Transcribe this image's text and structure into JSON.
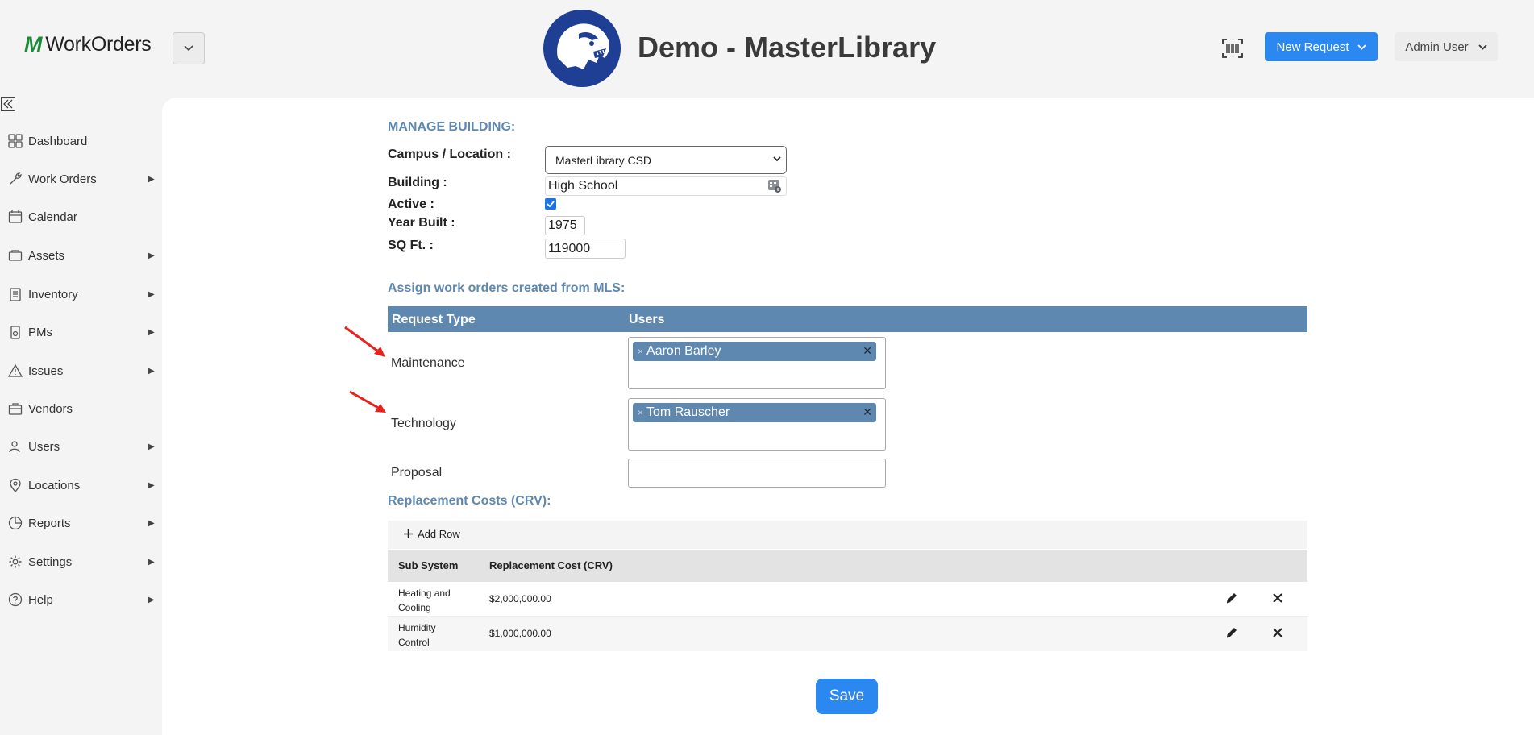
{
  "header": {
    "logo_mark": "M",
    "logo_text": "WorkOrders",
    "title": "Demo - MasterLibrary",
    "new_request_label": "New Request",
    "admin_user_label": "Admin User"
  },
  "sidebar": {
    "items": [
      {
        "label": "Dashboard",
        "icon": "dashboard-icon",
        "has_submenu": false
      },
      {
        "label": "Work Orders",
        "icon": "work-orders-icon",
        "has_submenu": true
      },
      {
        "label": "Calendar",
        "icon": "calendar-icon",
        "has_submenu": false
      },
      {
        "label": "Assets",
        "icon": "assets-icon",
        "has_submenu": true
      },
      {
        "label": "Inventory",
        "icon": "inventory-icon",
        "has_submenu": true
      },
      {
        "label": "PMs",
        "icon": "pms-icon",
        "has_submenu": true
      },
      {
        "label": "Issues",
        "icon": "warning-icon",
        "has_submenu": true
      },
      {
        "label": "Vendors",
        "icon": "briefcase-icon",
        "has_submenu": false
      },
      {
        "label": "Users",
        "icon": "users-icon",
        "has_submenu": true
      },
      {
        "label": "Locations",
        "icon": "location-pin-icon",
        "has_submenu": true
      },
      {
        "label": "Reports",
        "icon": "reports-icon",
        "has_submenu": true
      },
      {
        "label": "Settings",
        "icon": "gear-icon",
        "has_submenu": true
      },
      {
        "label": "Help",
        "icon": "help-icon",
        "has_submenu": true
      }
    ]
  },
  "manage_building": {
    "title": "MANAGE BUILDING:",
    "campus_label": "Campus / Location :",
    "campus_value": "MasterLibrary CSD",
    "building_label": "Building :",
    "building_value": "High School",
    "active_label": "Active :",
    "active_checked": true,
    "year_built_label": "Year Built :",
    "year_built_value": "1975",
    "sqft_label": "SQ Ft. :",
    "sqft_value": "119000"
  },
  "assign": {
    "title": "Assign work orders created from MLS:",
    "col_request_type": "Request Type",
    "col_users": "Users",
    "rows": [
      {
        "request_type": "Maintenance",
        "user": "Aaron Barley"
      },
      {
        "request_type": "Technology",
        "user": "Tom Rauscher"
      },
      {
        "request_type": "Proposal",
        "user": ""
      }
    ]
  },
  "crv": {
    "title": "Replacement Costs (CRV):",
    "add_row_label": "Add Row",
    "col_sub_system": "Sub System",
    "col_cost": "Replacement Cost (CRV)",
    "rows": [
      {
        "sub_system": "Heating and Cooling",
        "cost": "$2,000,000.00"
      },
      {
        "sub_system": "Humidity Control",
        "cost": "$1,000,000.00"
      }
    ]
  },
  "save_label": "Save",
  "colors": {
    "accent_blue": "#2b88f0",
    "section_blue": "#5f88b0",
    "mascot_blue": "#1e3f93",
    "logo_green": "#1f8a3a",
    "annotation_arrow": "#e8211d"
  }
}
